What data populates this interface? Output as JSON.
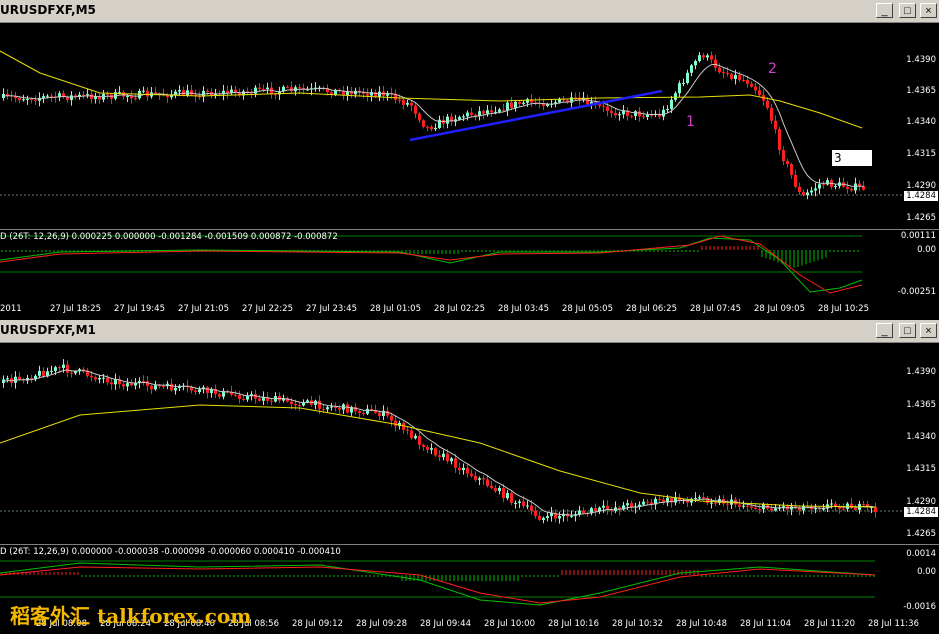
{
  "windows": [
    {
      "title": "URUSDFXF,M5",
      "buttons": {
        "minimize": "_",
        "maximize": "□",
        "close": "×"
      },
      "price_axis": [
        "1.4390",
        "1.4365",
        "1.4340",
        "1.4315",
        "1.4290",
        "1.4265"
      ],
      "current_price": "1.4284",
      "macd_label": "D  (26T:  12,26,9) 0.000225 0.000000 -0.001284 -0.001509 0.000872 -0.000872",
      "macd_axis": [
        "0.00111",
        "0.00",
        "-0.00251"
      ],
      "time_labels": [
        "2011",
        "27 Jul 18:25",
        "27 Jul 19:45",
        "27 Jul 21:05",
        "27 Jul 22:25",
        "27 Jul 23:45",
        "28 Jul 01:05",
        "28 Jul 02:25",
        "28 Jul 03:45",
        "28 Jul 05:05",
        "28 Jul 06:25",
        "28 Jul 07:45",
        "28 Jul 09:05",
        "28 Jul 10:25"
      ],
      "annotations": {
        "one": "1",
        "two": "2",
        "three": "3"
      }
    },
    {
      "title": "URUSDFXF,M1",
      "buttons": {
        "minimize": "_",
        "maximize": "□",
        "close": "×"
      },
      "price_axis": [
        "1.4390",
        "1.4365",
        "1.4340",
        "1.4315",
        "1.4290",
        "1.4265"
      ],
      "current_price": "1.4284",
      "macd_label": "D  (26T:  12,26,9) 0.000000 -0.000038 -0.000098 -0.000060 0.000410 -0.000410",
      "macd_axis": [
        "0.0014",
        "0.00",
        "-0.0016"
      ],
      "time_labels": [
        "28 Jul 08:08",
        "28 Jul 08:24",
        "28 Jul 08:40",
        "28 Jul 08:56",
        "28 Jul 09:12",
        "28 Jul 09:28",
        "28 Jul 09:44",
        "28 Jul 10:00",
        "28 Jul 10:16",
        "28 Jul 10:32",
        "28 Jul 10:48",
        "28 Jul 11:04",
        "28 Jul 11:20",
        "28 Jul 11:36"
      ]
    }
  ],
  "watermark": "稻客外汇 talkforex.com",
  "colors": {
    "bull": "#7fffd4",
    "bear": "#ff2020",
    "ma_fast": "#c8c8c8",
    "ma_slow": "#e8e000",
    "macd": "#00c000",
    "signal": "#ff2020",
    "trendline": "#2020ff",
    "annotation": "#d040d0"
  }
}
